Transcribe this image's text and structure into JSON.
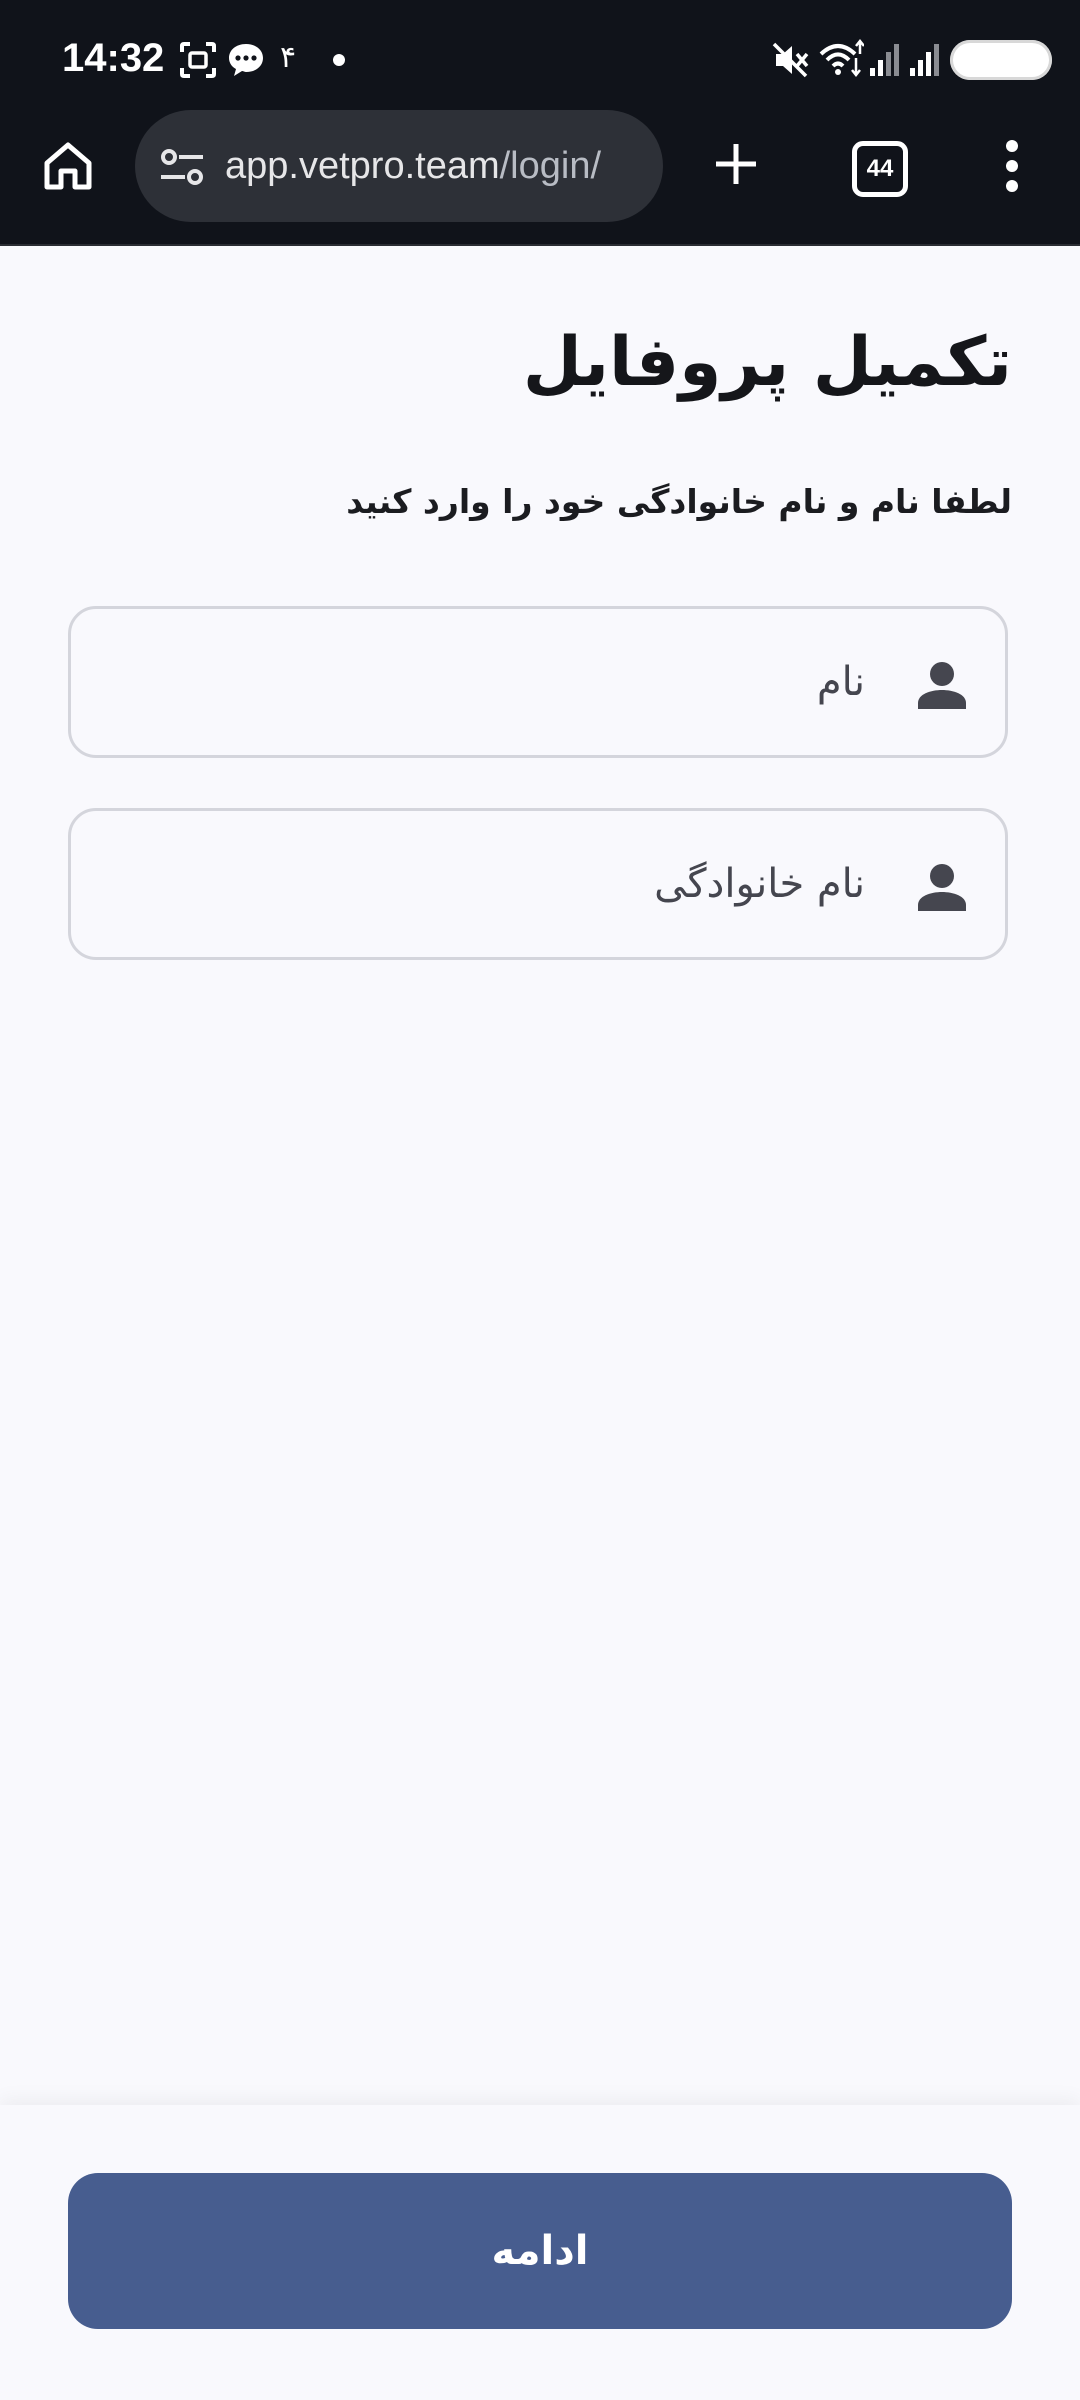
{
  "status_bar": {
    "time": "14:32",
    "notification_count": "۴"
  },
  "browser": {
    "url_host": "app.vetpro.team",
    "url_path": "/login/",
    "tab_count": "44"
  },
  "page": {
    "title": "تکمیل پروفایل",
    "subtitle": "لطفا نام و نام خانوادگی خود را وارد کنید",
    "first_name": {
      "value": "",
      "placeholder": "نام"
    },
    "last_name": {
      "value": "",
      "placeholder": "نام خانوادگی"
    },
    "continue_label": "ادامه"
  },
  "colors": {
    "primary": "#475d8f",
    "background": "#f9f9fd",
    "system_bar": "#10131a"
  },
  "icons": {
    "home": "home-icon",
    "site_settings": "tune-icon",
    "new_tab": "plus-icon",
    "menu": "more-vert-icon",
    "field": "person-icon"
  }
}
